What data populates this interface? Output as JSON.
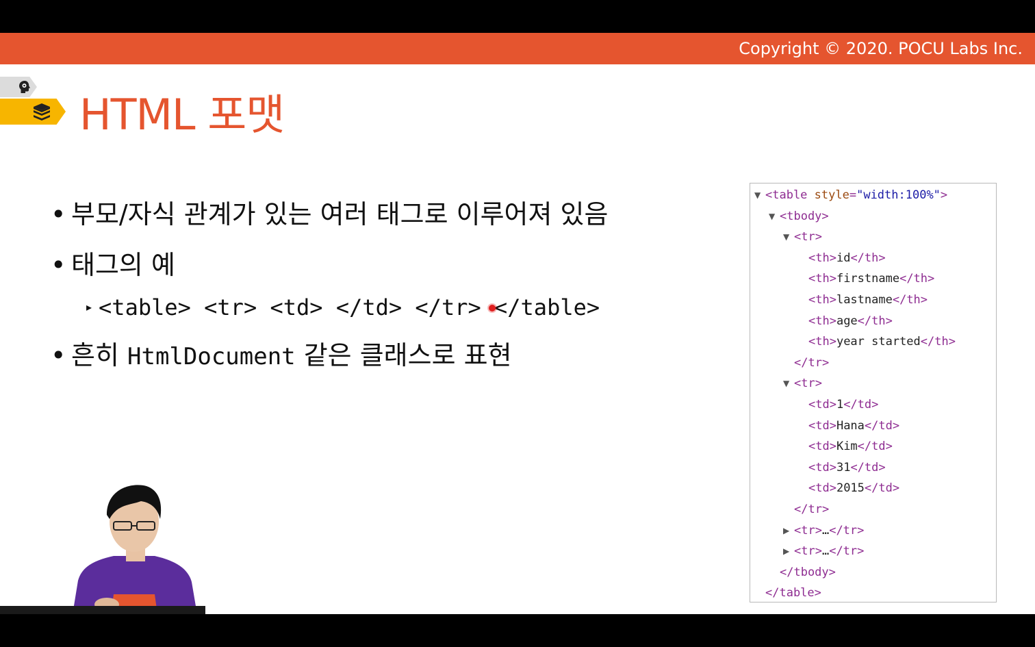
{
  "header": {
    "copyright": "Copyright © 2020. POCU Labs Inc."
  },
  "title": "HTML 포맷",
  "bullets": [
    {
      "text": "부모/자식 관계가 있는 여러 태그로 이루어져 있음"
    },
    {
      "text": "태그의 예"
    },
    {
      "prefix": "흔히 ",
      "code": "HtmlDocument",
      "suffix": " 같은 클래스로 표현"
    }
  ],
  "bullet_dot": "•",
  "sub_item": "<table> <tr> <td> </td> </tr> </table>",
  "sub_marker": "▸",
  "code_panel": {
    "lines": [
      {
        "caret": "▼",
        "text": "<table style=\"width:100%\">"
      },
      {
        "caret": "▼",
        "text": "<tbody>"
      },
      {
        "caret": "▼",
        "text": "<tr>"
      },
      {
        "caret": "",
        "text": "<th>id</th>"
      },
      {
        "caret": "",
        "text": "<th>firstname</th>"
      },
      {
        "caret": "",
        "text": "<th>lastname</th>"
      },
      {
        "caret": "",
        "text": "<th>age</th>"
      },
      {
        "caret": "",
        "text": "<th>year started</th>"
      },
      {
        "caret": "",
        "text": "</tr>"
      },
      {
        "caret": "▼",
        "text": "<tr>"
      },
      {
        "caret": "",
        "text": "<td>1</td>"
      },
      {
        "caret": "",
        "text": "<td>Hana</td>"
      },
      {
        "caret": "",
        "text": "<td>Kim</td>"
      },
      {
        "caret": "",
        "text": "<td>31</td>"
      },
      {
        "caret": "",
        "text": "<td>2015</td>"
      },
      {
        "caret": "",
        "text": "</tr>"
      },
      {
        "caret": "▶",
        "text": "<tr>…</tr>"
      },
      {
        "caret": "▶",
        "text": "<tr>…</tr>"
      },
      {
        "caret": "",
        "text": "</tbody>"
      },
      {
        "caret": "",
        "text": "</table>"
      }
    ]
  },
  "icons": {
    "gray_tab": "head-gear-icon",
    "yellow_tab": "stacked-books-icon"
  },
  "colors": {
    "accent": "#e5552f",
    "tab_yellow": "#f7b500",
    "tag": "#8e2c91",
    "attr": "#9b4a10",
    "value": "#1a1aa6"
  }
}
